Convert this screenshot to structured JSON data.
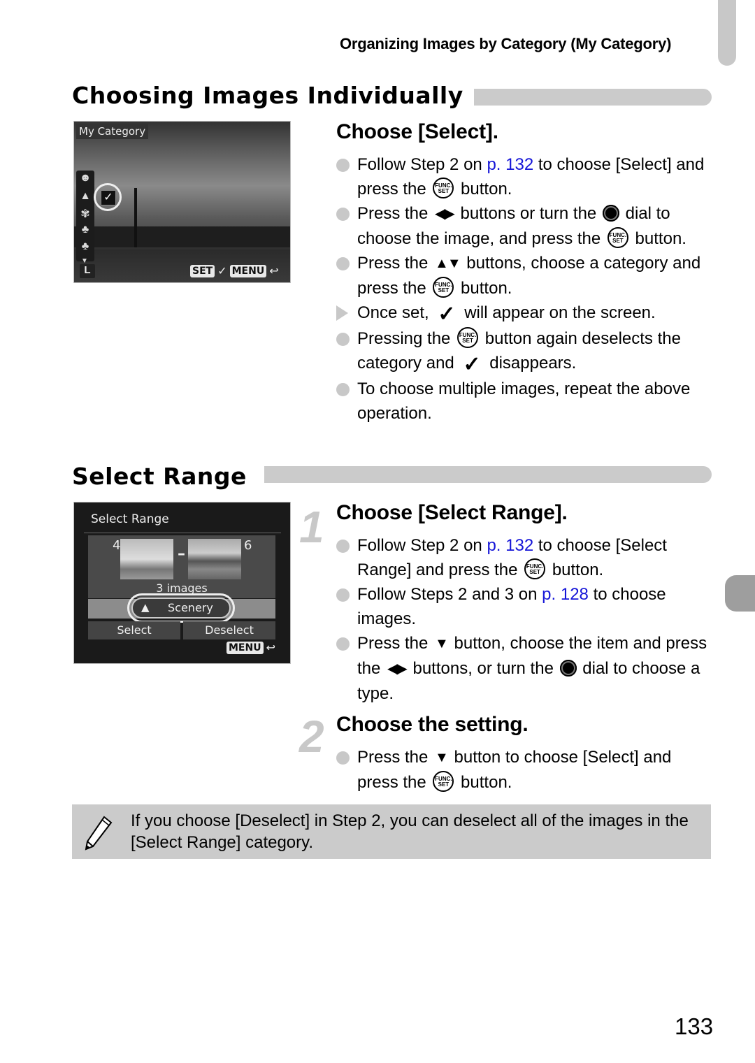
{
  "header": {
    "running_title": "Organizing Images by Category (My Category)"
  },
  "section1": {
    "title": "Choosing Images Individually",
    "step_heading": "Choose [Select].",
    "screen": {
      "title": "My Category",
      "set_label": "SET",
      "check": "✓",
      "menu_label": "MENU",
      "back_glyph": "↩",
      "size_label": "L",
      "categories": [
        "people-icon",
        "scenery-icon",
        "events-icon",
        "category-1-icon",
        "category-2-icon"
      ]
    },
    "bullets": [
      {
        "type": "circle",
        "parts": [
          {
            "t": "Follow Step 2 on "
          },
          {
            "t": "p. 132",
            "link": true
          },
          {
            "t": " to choose [Select] and press the "
          },
          {
            "icon": "func"
          },
          {
            "t": " button."
          }
        ]
      },
      {
        "type": "circle",
        "parts": [
          {
            "t": "Press the "
          },
          {
            "icon": "leftright"
          },
          {
            "t": " buttons or turn the "
          },
          {
            "icon": "dial"
          },
          {
            "t": " dial to choose the image, and press the "
          },
          {
            "icon": "func"
          },
          {
            "t": " button."
          }
        ]
      },
      {
        "type": "circle",
        "parts": [
          {
            "t": "Press the "
          },
          {
            "icon": "updown"
          },
          {
            "t": " buttons, choose a category and press the "
          },
          {
            "icon": "func"
          },
          {
            "t": " button."
          }
        ]
      },
      {
        "type": "triangle",
        "parts": [
          {
            "t": "Once set, "
          },
          {
            "icon": "check"
          },
          {
            "t": " will appear on the screen."
          }
        ]
      },
      {
        "type": "circle",
        "parts": [
          {
            "t": "Pressing the "
          },
          {
            "icon": "func"
          },
          {
            "t": " button again deselects the category and "
          },
          {
            "icon": "check"
          },
          {
            "t": " disappears."
          }
        ]
      },
      {
        "type": "circle",
        "parts": [
          {
            "t": "To choose multiple images, repeat the above operation."
          }
        ]
      }
    ]
  },
  "section2": {
    "title": "Select Range",
    "screen": {
      "title": "Select Range",
      "start_number": "4",
      "end_number": "6",
      "dash": "–",
      "count_label": "3 images",
      "category_label": "Scenery",
      "select_label": "Select",
      "deselect_label": "Deselect",
      "menu_label": "MENU",
      "back_glyph": "↩"
    },
    "steps": [
      {
        "number": "1",
        "heading": "Choose [Select Range].",
        "bullets": [
          {
            "type": "circle",
            "parts": [
              {
                "t": "Follow Step 2 on "
              },
              {
                "t": "p. 132",
                "link": true
              },
              {
                "t": " to choose [Select Range] and press the "
              },
              {
                "icon": "func"
              },
              {
                "t": " button."
              }
            ]
          },
          {
            "type": "circle",
            "parts": [
              {
                "t": "Follow Steps 2 and 3 on "
              },
              {
                "t": "p. 128",
                "link": true
              },
              {
                "t": " to choose images."
              }
            ]
          },
          {
            "type": "circle",
            "parts": [
              {
                "t": "Press the "
              },
              {
                "icon": "down"
              },
              {
                "t": " button, choose the item and press the "
              },
              {
                "icon": "leftright"
              },
              {
                "t": " buttons, or turn the "
              },
              {
                "icon": "dial"
              },
              {
                "t": " dial to choose a type."
              }
            ]
          }
        ]
      },
      {
        "number": "2",
        "heading": "Choose the setting.",
        "bullets": [
          {
            "type": "circle",
            "parts": [
              {
                "t": "Press the "
              },
              {
                "icon": "down"
              },
              {
                "t": " button to choose [Select] and press the "
              },
              {
                "icon": "func"
              },
              {
                "t": " button."
              }
            ]
          }
        ]
      }
    ]
  },
  "note": {
    "icon": "pencil-icon",
    "text": "If you choose [Deselect] in Step 2, you can deselect all of the images in the [Select Range] category."
  },
  "icons": {
    "func_top": "FUNC.",
    "func_bottom": "SET",
    "leftright": "◀▶",
    "updown": "▲▼",
    "down": "▼",
    "check": "✓"
  },
  "page_number": "133",
  "colors": {
    "link": "#1515d8",
    "accent_gray": "#cbcbcb",
    "side_tab": "#9e9e9e"
  }
}
